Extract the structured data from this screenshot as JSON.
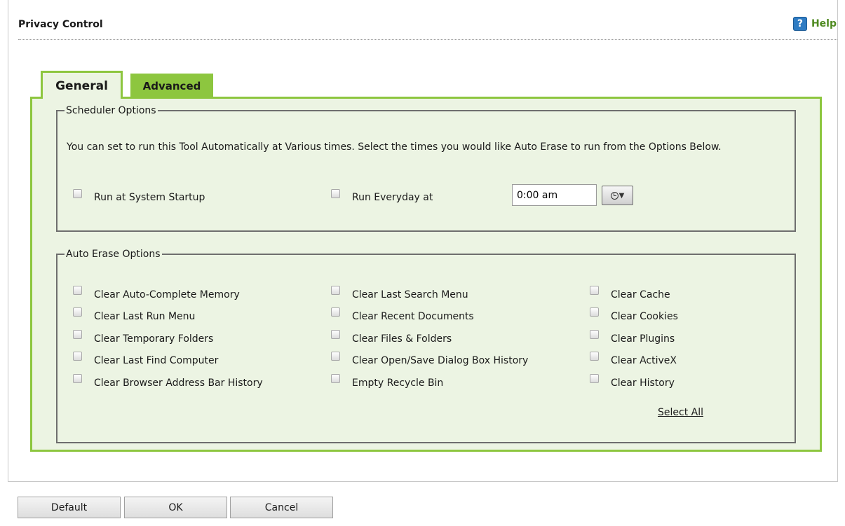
{
  "header": {
    "title": "Privacy Control",
    "help_label": "Help",
    "help_icon": "help-icon"
  },
  "tabs": [
    {
      "label": "General",
      "active": true
    },
    {
      "label": "Advanced",
      "active": false
    }
  ],
  "scheduler": {
    "legend": "Scheduler Options",
    "description": "You can set to run this Tool Automatically at Various times. Select the times you would like Auto Erase to run from the Options Below.",
    "run_startup_label": "Run at System Startup",
    "run_everyday_label": "Run Everyday at",
    "time_value": "0:00 am"
  },
  "auto_erase": {
    "legend": "Auto Erase Options",
    "col1": [
      "Clear Auto-Complete Memory",
      "Clear Last Run Menu",
      "Clear Temporary Folders",
      "Clear Last Find Computer",
      "Clear Browser Address Bar History"
    ],
    "col2": [
      "Clear Last Search Menu",
      "Clear Recent Documents",
      "Clear Files & Folders",
      "Clear Open/Save Dialog Box History",
      "Empty Recycle Bin"
    ],
    "col3": [
      "Clear Cache",
      "Clear Cookies",
      "Clear Plugins",
      "Clear ActiveX",
      "Clear History"
    ],
    "select_all": "Select All"
  },
  "buttons": {
    "default": "Default",
    "ok": "OK",
    "cancel": "Cancel"
  },
  "colors": {
    "accent_green": "#8dc63f",
    "panel_bg": "#ecf4e3",
    "help_text": "#4e8a1f",
    "help_icon_bg": "#2f7cc3"
  }
}
